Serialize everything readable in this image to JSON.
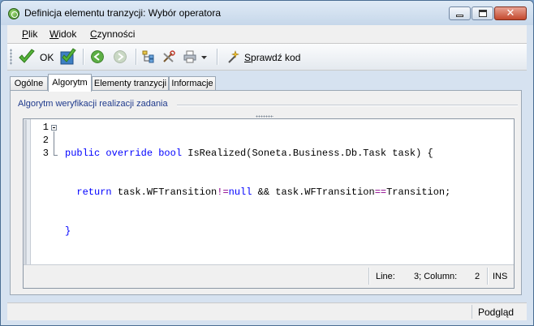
{
  "window": {
    "title": "Definicja elementu tranzycji: Wybór operatora",
    "close_glyph": "✕"
  },
  "menu": [
    {
      "label": "Plik",
      "mnemonic": "P",
      "rest": "lik"
    },
    {
      "label": "Widok",
      "mnemonic": "W",
      "rest": "idok"
    },
    {
      "label": "Czynności",
      "mnemonic": "C",
      "rest": "zynności"
    }
  ],
  "toolbar": {
    "ok_label": "OK",
    "check_code_mnemonic": "S",
    "check_code_rest": "prawdź kod",
    "icons": [
      "ok-check-icon",
      "save-check-icon",
      "back-arrow-icon",
      "forward-arrow-icon",
      "tree-icon",
      "tools-icon",
      "print-icon",
      "dropdown-arrow-icon",
      "wand-icon"
    ]
  },
  "tabs": [
    {
      "label": "Ogólne",
      "active": false
    },
    {
      "label": "Algorytm",
      "active": true
    },
    {
      "label": "Elementy tranzycji",
      "active": false
    },
    {
      "label": "Informacje",
      "active": false
    }
  ],
  "panel": {
    "group_title": "Algorytm weryfikacji realizacji zadania"
  },
  "editor": {
    "line_numbers": [
      "1",
      "2",
      "3"
    ],
    "line1": {
      "kw1": "public",
      "kw2": "override",
      "kw3": "bool",
      "rest": " IsRealized(Soneta.Business.Db.Task task) {"
    },
    "line2": {
      "kw1": "return",
      "a": " task.WFTransition",
      "op1": "!=",
      "kw2": "null",
      "b": " && task.WFTransition",
      "op2": "==",
      "c": "Transition;"
    },
    "line3": "}",
    "status": {
      "line_label": "Line:",
      "position_value": "3; Column:",
      "column_value": "2",
      "mode": "INS"
    }
  },
  "footer": {
    "preview": "Podgląd"
  },
  "colors": {
    "keyword": "#0000ff",
    "operator": "#8b008b",
    "group_title": "#1f3a8c"
  }
}
